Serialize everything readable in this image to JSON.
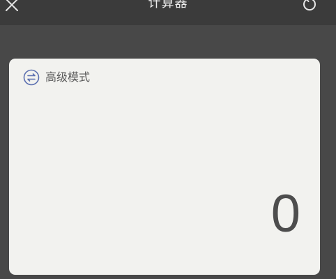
{
  "header": {
    "title": "计算器",
    "close_icon": "close-icon",
    "refresh_icon": "refresh-icon"
  },
  "calculator": {
    "mode_toggle_label": "高级模式",
    "mode_toggle_icon": "swap-icon",
    "display_value": "0"
  },
  "colors": {
    "background": "#484848",
    "topbar": "#3b3b3b",
    "card": "#f2f2ef",
    "accent_icon": "#5b6fb0"
  }
}
